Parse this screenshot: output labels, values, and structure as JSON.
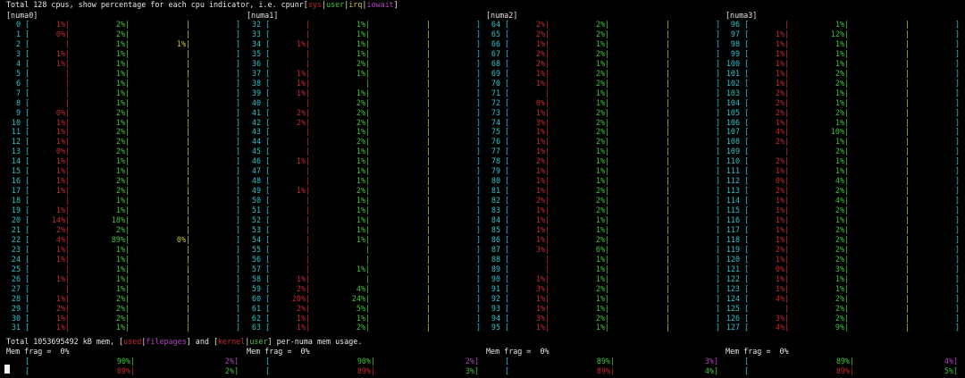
{
  "header": {
    "prefix": "Total 128 cpus, show percentage for each cpu indicator, i.e. cpunr[",
    "sys": "sys",
    "usr": "user",
    "irq": "irq",
    "iow": "iowait",
    "suffix": "]"
  },
  "colors": {
    "cpu_number": "#2bc4c9",
    "sys": "#c5282f",
    "user": "#3fc43a",
    "irq": "#c9c42b",
    "iowait": "#b040c0",
    "background": "#000000"
  },
  "numa": [
    {
      "label": "[numa0]",
      "rows": [
        {
          "cpu": "0",
          "sys": "1%",
          "usr": "2%",
          "irq": "",
          "iow": ""
        },
        {
          "cpu": "1",
          "sys": "0%",
          "usr": "2%",
          "irq": "",
          "iow": ""
        },
        {
          "cpu": "2",
          "sys": "",
          "usr": "1%",
          "irq": "1%",
          "iow": ""
        },
        {
          "cpu": "3",
          "sys": "1%",
          "usr": "1%",
          "irq": "",
          "iow": ""
        },
        {
          "cpu": "4",
          "sys": "1%",
          "usr": "1%",
          "irq": "",
          "iow": ""
        },
        {
          "cpu": "5",
          "sys": "",
          "usr": "1%",
          "irq": "",
          "iow": ""
        },
        {
          "cpu": "6",
          "sys": "",
          "usr": "1%",
          "irq": "",
          "iow": ""
        },
        {
          "cpu": "7",
          "sys": "",
          "usr": "1%",
          "irq": "",
          "iow": ""
        },
        {
          "cpu": "8",
          "sys": "",
          "usr": "1%",
          "irq": "",
          "iow": ""
        },
        {
          "cpu": "9",
          "sys": "0%",
          "usr": "2%",
          "irq": "",
          "iow": ""
        },
        {
          "cpu": "10",
          "sys": "1%",
          "usr": "1%",
          "irq": "",
          "iow": ""
        },
        {
          "cpu": "11",
          "sys": "1%",
          "usr": "2%",
          "irq": "",
          "iow": ""
        },
        {
          "cpu": "12",
          "sys": "1%",
          "usr": "2%",
          "irq": "",
          "iow": ""
        },
        {
          "cpu": "13",
          "sys": "0%",
          "usr": "2%",
          "irq": "",
          "iow": ""
        },
        {
          "cpu": "14",
          "sys": "1%",
          "usr": "1%",
          "irq": "",
          "iow": ""
        },
        {
          "cpu": "15",
          "sys": "1%",
          "usr": "1%",
          "irq": "",
          "iow": ""
        },
        {
          "cpu": "16",
          "sys": "1%",
          "usr": "2%",
          "irq": "",
          "iow": ""
        },
        {
          "cpu": "17",
          "sys": "1%",
          "usr": "2%",
          "irq": "",
          "iow": ""
        },
        {
          "cpu": "18",
          "sys": "",
          "usr": "1%",
          "irq": "",
          "iow": ""
        },
        {
          "cpu": "19",
          "sys": "1%",
          "usr": "1%",
          "irq": "",
          "iow": ""
        },
        {
          "cpu": "20",
          "sys": "14%",
          "usr": "18%",
          "irq": "",
          "iow": ""
        },
        {
          "cpu": "21",
          "sys": "2%",
          "usr": "2%",
          "irq": "",
          "iow": ""
        },
        {
          "cpu": "22",
          "sys": "4%",
          "usr": "89%",
          "irq": "0%",
          "iow": ""
        },
        {
          "cpu": "23",
          "sys": "1%",
          "usr": "1%",
          "irq": "",
          "iow": ""
        },
        {
          "cpu": "24",
          "sys": "1%",
          "usr": "1%",
          "irq": "",
          "iow": ""
        },
        {
          "cpu": "25",
          "sys": "",
          "usr": "1%",
          "irq": "",
          "iow": ""
        },
        {
          "cpu": "26",
          "sys": "1%",
          "usr": "1%",
          "irq": "",
          "iow": ""
        },
        {
          "cpu": "27",
          "sys": "",
          "usr": "1%",
          "irq": "",
          "iow": ""
        },
        {
          "cpu": "28",
          "sys": "1%",
          "usr": "2%",
          "irq": "",
          "iow": ""
        },
        {
          "cpu": "29",
          "sys": "2%",
          "usr": "2%",
          "irq": "",
          "iow": ""
        },
        {
          "cpu": "30",
          "sys": "1%",
          "usr": "2%",
          "irq": "",
          "iow": ""
        },
        {
          "cpu": "31",
          "sys": "1%",
          "usr": "1%",
          "irq": "",
          "iow": ""
        }
      ]
    },
    {
      "label": "[numa1]",
      "rows": [
        {
          "cpu": "32",
          "sys": "",
          "usr": "1%",
          "irq": "",
          "iow": ""
        },
        {
          "cpu": "33",
          "sys": "",
          "usr": "1%",
          "irq": "",
          "iow": ""
        },
        {
          "cpu": "34",
          "sys": "1%",
          "usr": "1%",
          "irq": "",
          "iow": ""
        },
        {
          "cpu": "35",
          "sys": "",
          "usr": "1%",
          "irq": "",
          "iow": ""
        },
        {
          "cpu": "36",
          "sys": "",
          "usr": "2%",
          "irq": "",
          "iow": ""
        },
        {
          "cpu": "37",
          "sys": "1%",
          "usr": "1%",
          "irq": "",
          "iow": ""
        },
        {
          "cpu": "38",
          "sys": "1%",
          "usr": "",
          "irq": "",
          "iow": ""
        },
        {
          "cpu": "39",
          "sys": "1%",
          "usr": "1%",
          "irq": "",
          "iow": ""
        },
        {
          "cpu": "40",
          "sys": "",
          "usr": "2%",
          "irq": "",
          "iow": ""
        },
        {
          "cpu": "41",
          "sys": "2%",
          "usr": "2%",
          "irq": "",
          "iow": ""
        },
        {
          "cpu": "42",
          "sys": "2%",
          "usr": "2%",
          "irq": "",
          "iow": ""
        },
        {
          "cpu": "43",
          "sys": "",
          "usr": "1%",
          "irq": "",
          "iow": ""
        },
        {
          "cpu": "44",
          "sys": "",
          "usr": "2%",
          "irq": "",
          "iow": ""
        },
        {
          "cpu": "45",
          "sys": "",
          "usr": "1%",
          "irq": "",
          "iow": ""
        },
        {
          "cpu": "46",
          "sys": "1%",
          "usr": "1%",
          "irq": "",
          "iow": ""
        },
        {
          "cpu": "47",
          "sys": "",
          "usr": "1%",
          "irq": "",
          "iow": ""
        },
        {
          "cpu": "48",
          "sys": "",
          "usr": "1%",
          "irq": "",
          "iow": ""
        },
        {
          "cpu": "49",
          "sys": "1%",
          "usr": "2%",
          "irq": "",
          "iow": ""
        },
        {
          "cpu": "50",
          "sys": "",
          "usr": "1%",
          "irq": "",
          "iow": ""
        },
        {
          "cpu": "51",
          "sys": "",
          "usr": "1%",
          "irq": "",
          "iow": ""
        },
        {
          "cpu": "52",
          "sys": "",
          "usr": "1%",
          "irq": "",
          "iow": ""
        },
        {
          "cpu": "53",
          "sys": "",
          "usr": "1%",
          "irq": "",
          "iow": ""
        },
        {
          "cpu": "54",
          "sys": "",
          "usr": "1%",
          "irq": "",
          "iow": ""
        },
        {
          "cpu": "55",
          "sys": "",
          "usr": "",
          "irq": "",
          "iow": ""
        },
        {
          "cpu": "56",
          "sys": "",
          "usr": "",
          "irq": "",
          "iow": ""
        },
        {
          "cpu": "57",
          "sys": "",
          "usr": "1%",
          "irq": "",
          "iow": ""
        },
        {
          "cpu": "58",
          "sys": "1%",
          "usr": "",
          "irq": "",
          "iow": ""
        },
        {
          "cpu": "59",
          "sys": "2%",
          "usr": "4%",
          "irq": "",
          "iow": ""
        },
        {
          "cpu": "60",
          "sys": "20%",
          "usr": "24%",
          "irq": "",
          "iow": ""
        },
        {
          "cpu": "61",
          "sys": "2%",
          "usr": "5%",
          "irq": "",
          "iow": ""
        },
        {
          "cpu": "62",
          "sys": "1%",
          "usr": "1%",
          "irq": "",
          "iow": ""
        },
        {
          "cpu": "63",
          "sys": "1%",
          "usr": "2%",
          "irq": "",
          "iow": ""
        }
      ]
    },
    {
      "label": "[numa2]",
      "rows": [
        {
          "cpu": "64",
          "sys": "2%",
          "usr": "2%",
          "irq": "",
          "iow": ""
        },
        {
          "cpu": "65",
          "sys": "2%",
          "usr": "2%",
          "irq": "",
          "iow": ""
        },
        {
          "cpu": "66",
          "sys": "1%",
          "usr": "1%",
          "irq": "",
          "iow": ""
        },
        {
          "cpu": "67",
          "sys": "2%",
          "usr": "2%",
          "irq": "",
          "iow": ""
        },
        {
          "cpu": "68",
          "sys": "2%",
          "usr": "1%",
          "irq": "",
          "iow": ""
        },
        {
          "cpu": "69",
          "sys": "1%",
          "usr": "2%",
          "irq": "",
          "iow": ""
        },
        {
          "cpu": "70",
          "sys": "1%",
          "usr": "2%",
          "irq": "",
          "iow": ""
        },
        {
          "cpu": "71",
          "sys": "",
          "usr": "1%",
          "irq": "",
          "iow": ""
        },
        {
          "cpu": "72",
          "sys": "0%",
          "usr": "1%",
          "irq": "",
          "iow": ""
        },
        {
          "cpu": "73",
          "sys": "1%",
          "usr": "2%",
          "irq": "",
          "iow": ""
        },
        {
          "cpu": "74",
          "sys": "3%",
          "usr": "2%",
          "irq": "",
          "iow": ""
        },
        {
          "cpu": "75",
          "sys": "1%",
          "usr": "2%",
          "irq": "",
          "iow": ""
        },
        {
          "cpu": "76",
          "sys": "1%",
          "usr": "2%",
          "irq": "",
          "iow": ""
        },
        {
          "cpu": "77",
          "sys": "1%",
          "usr": "1%",
          "irq": "",
          "iow": ""
        },
        {
          "cpu": "78",
          "sys": "2%",
          "usr": "1%",
          "irq": "",
          "iow": ""
        },
        {
          "cpu": "79",
          "sys": "1%",
          "usr": "1%",
          "irq": "",
          "iow": ""
        },
        {
          "cpu": "80",
          "sys": "1%",
          "usr": "1%",
          "irq": "",
          "iow": ""
        },
        {
          "cpu": "81",
          "sys": "1%",
          "usr": "2%",
          "irq": "",
          "iow": ""
        },
        {
          "cpu": "82",
          "sys": "2%",
          "usr": "2%",
          "irq": "",
          "iow": ""
        },
        {
          "cpu": "83",
          "sys": "1%",
          "usr": "2%",
          "irq": "",
          "iow": ""
        },
        {
          "cpu": "84",
          "sys": "1%",
          "usr": "1%",
          "irq": "",
          "iow": ""
        },
        {
          "cpu": "85",
          "sys": "1%",
          "usr": "1%",
          "irq": "",
          "iow": ""
        },
        {
          "cpu": "86",
          "sys": "1%",
          "usr": "2%",
          "irq": "",
          "iow": ""
        },
        {
          "cpu": "87",
          "sys": "3%",
          "usr": "6%",
          "irq": "",
          "iow": ""
        },
        {
          "cpu": "88",
          "sys": "",
          "usr": "1%",
          "irq": "",
          "iow": ""
        },
        {
          "cpu": "89",
          "sys": "",
          "usr": "1%",
          "irq": "",
          "iow": ""
        },
        {
          "cpu": "90",
          "sys": "1%",
          "usr": "1%",
          "irq": "",
          "iow": ""
        },
        {
          "cpu": "91",
          "sys": "3%",
          "usr": "2%",
          "irq": "",
          "iow": ""
        },
        {
          "cpu": "92",
          "sys": "1%",
          "usr": "1%",
          "irq": "",
          "iow": ""
        },
        {
          "cpu": "93",
          "sys": "1%",
          "usr": "1%",
          "irq": "",
          "iow": ""
        },
        {
          "cpu": "94",
          "sys": "3%",
          "usr": "2%",
          "irq": "",
          "iow": ""
        },
        {
          "cpu": "95",
          "sys": "1%",
          "usr": "1%",
          "irq": "",
          "iow": ""
        }
      ]
    },
    {
      "label": "[numa3]",
      "rows": [
        {
          "cpu": "96",
          "sys": "",
          "usr": "1%",
          "irq": "",
          "iow": ""
        },
        {
          "cpu": "97",
          "sys": "1%",
          "usr": "12%",
          "irq": "",
          "iow": ""
        },
        {
          "cpu": "98",
          "sys": "1%",
          "usr": "1%",
          "irq": "",
          "iow": ""
        },
        {
          "cpu": "99",
          "sys": "1%",
          "usr": "1%",
          "irq": "",
          "iow": ""
        },
        {
          "cpu": "100",
          "sys": "1%",
          "usr": "1%",
          "irq": "",
          "iow": ""
        },
        {
          "cpu": "101",
          "sys": "1%",
          "usr": "2%",
          "irq": "",
          "iow": ""
        },
        {
          "cpu": "102",
          "sys": "1%",
          "usr": "2%",
          "irq": "",
          "iow": ""
        },
        {
          "cpu": "103",
          "sys": "2%",
          "usr": "1%",
          "irq": "",
          "iow": ""
        },
        {
          "cpu": "104",
          "sys": "2%",
          "usr": "1%",
          "irq": "",
          "iow": ""
        },
        {
          "cpu": "105",
          "sys": "2%",
          "usr": "2%",
          "irq": "",
          "iow": ""
        },
        {
          "cpu": "106",
          "sys": "1%",
          "usr": "1%",
          "irq": "",
          "iow": ""
        },
        {
          "cpu": "107",
          "sys": "4%",
          "usr": "10%",
          "irq": "",
          "iow": ""
        },
        {
          "cpu": "108",
          "sys": "2%",
          "usr": "1%",
          "irq": "",
          "iow": ""
        },
        {
          "cpu": "109",
          "sys": "",
          "usr": "2%",
          "irq": "",
          "iow": ""
        },
        {
          "cpu": "110",
          "sys": "2%",
          "usr": "1%",
          "irq": "",
          "iow": ""
        },
        {
          "cpu": "111",
          "sys": "1%",
          "usr": "1%",
          "irq": "",
          "iow": ""
        },
        {
          "cpu": "112",
          "sys": "0%",
          "usr": "4%",
          "irq": "",
          "iow": ""
        },
        {
          "cpu": "113",
          "sys": "2%",
          "usr": "2%",
          "irq": "",
          "iow": ""
        },
        {
          "cpu": "114",
          "sys": "1%",
          "usr": "4%",
          "irq": "",
          "iow": ""
        },
        {
          "cpu": "115",
          "sys": "1%",
          "usr": "2%",
          "irq": "",
          "iow": ""
        },
        {
          "cpu": "116",
          "sys": "1%",
          "usr": "1%",
          "irq": "",
          "iow": ""
        },
        {
          "cpu": "117",
          "sys": "1%",
          "usr": "2%",
          "irq": "",
          "iow": ""
        },
        {
          "cpu": "118",
          "sys": "1%",
          "usr": "2%",
          "irq": "",
          "iow": ""
        },
        {
          "cpu": "119",
          "sys": "2%",
          "usr": "2%",
          "irq": "",
          "iow": ""
        },
        {
          "cpu": "120",
          "sys": "1%",
          "usr": "2%",
          "irq": "",
          "iow": ""
        },
        {
          "cpu": "121",
          "sys": "0%",
          "usr": "3%",
          "irq": "",
          "iow": ""
        },
        {
          "cpu": "122",
          "sys": "1%",
          "usr": "1%",
          "irq": "",
          "iow": ""
        },
        {
          "cpu": "123",
          "sys": "1%",
          "usr": "1%",
          "irq": "",
          "iow": ""
        },
        {
          "cpu": "124",
          "sys": "4%",
          "usr": "2%",
          "irq": "",
          "iow": ""
        },
        {
          "cpu": "125",
          "sys": "",
          "usr": "2%",
          "irq": "",
          "iow": ""
        },
        {
          "cpu": "126",
          "sys": "3%",
          "usr": "2%",
          "irq": "",
          "iow": ""
        },
        {
          "cpu": "127",
          "sys": "4%",
          "usr": "9%",
          "irq": "",
          "iow": ""
        }
      ]
    }
  ],
  "mem_header": {
    "prefix": "Total 1053695492 kB mem, [",
    "used": "used",
    "sep": "|",
    "filepages": "filepages",
    "mid": "] and [",
    "kernel": "kernel",
    "user": "user",
    "suffix": "] per-numa mem usage."
  },
  "mem": [
    {
      "frag": "Mem frag =  0%",
      "row1_a": "90%|",
      "row1_b": "2%]",
      "row2_a": "89%|",
      "row2_b": "2%]"
    },
    {
      "frag": "Mem frag =  0%",
      "row1_a": "90%|",
      "row1_b": "2%]",
      "row2_a": "89%|",
      "row2_b": "3%]"
    },
    {
      "frag": "Mem frag =  0%",
      "row1_a": "89%|",
      "row1_b": "3%]",
      "row2_a": "89%|",
      "row2_b": "4%]"
    },
    {
      "frag": "Mem frag =  0%",
      "row1_a": "89%|",
      "row1_b": "4%]",
      "row2_a": "89%|",
      "row2_b": "5%]"
    }
  ],
  "bracket_open": "[",
  "bracket_close": "]",
  "pipe": "|"
}
